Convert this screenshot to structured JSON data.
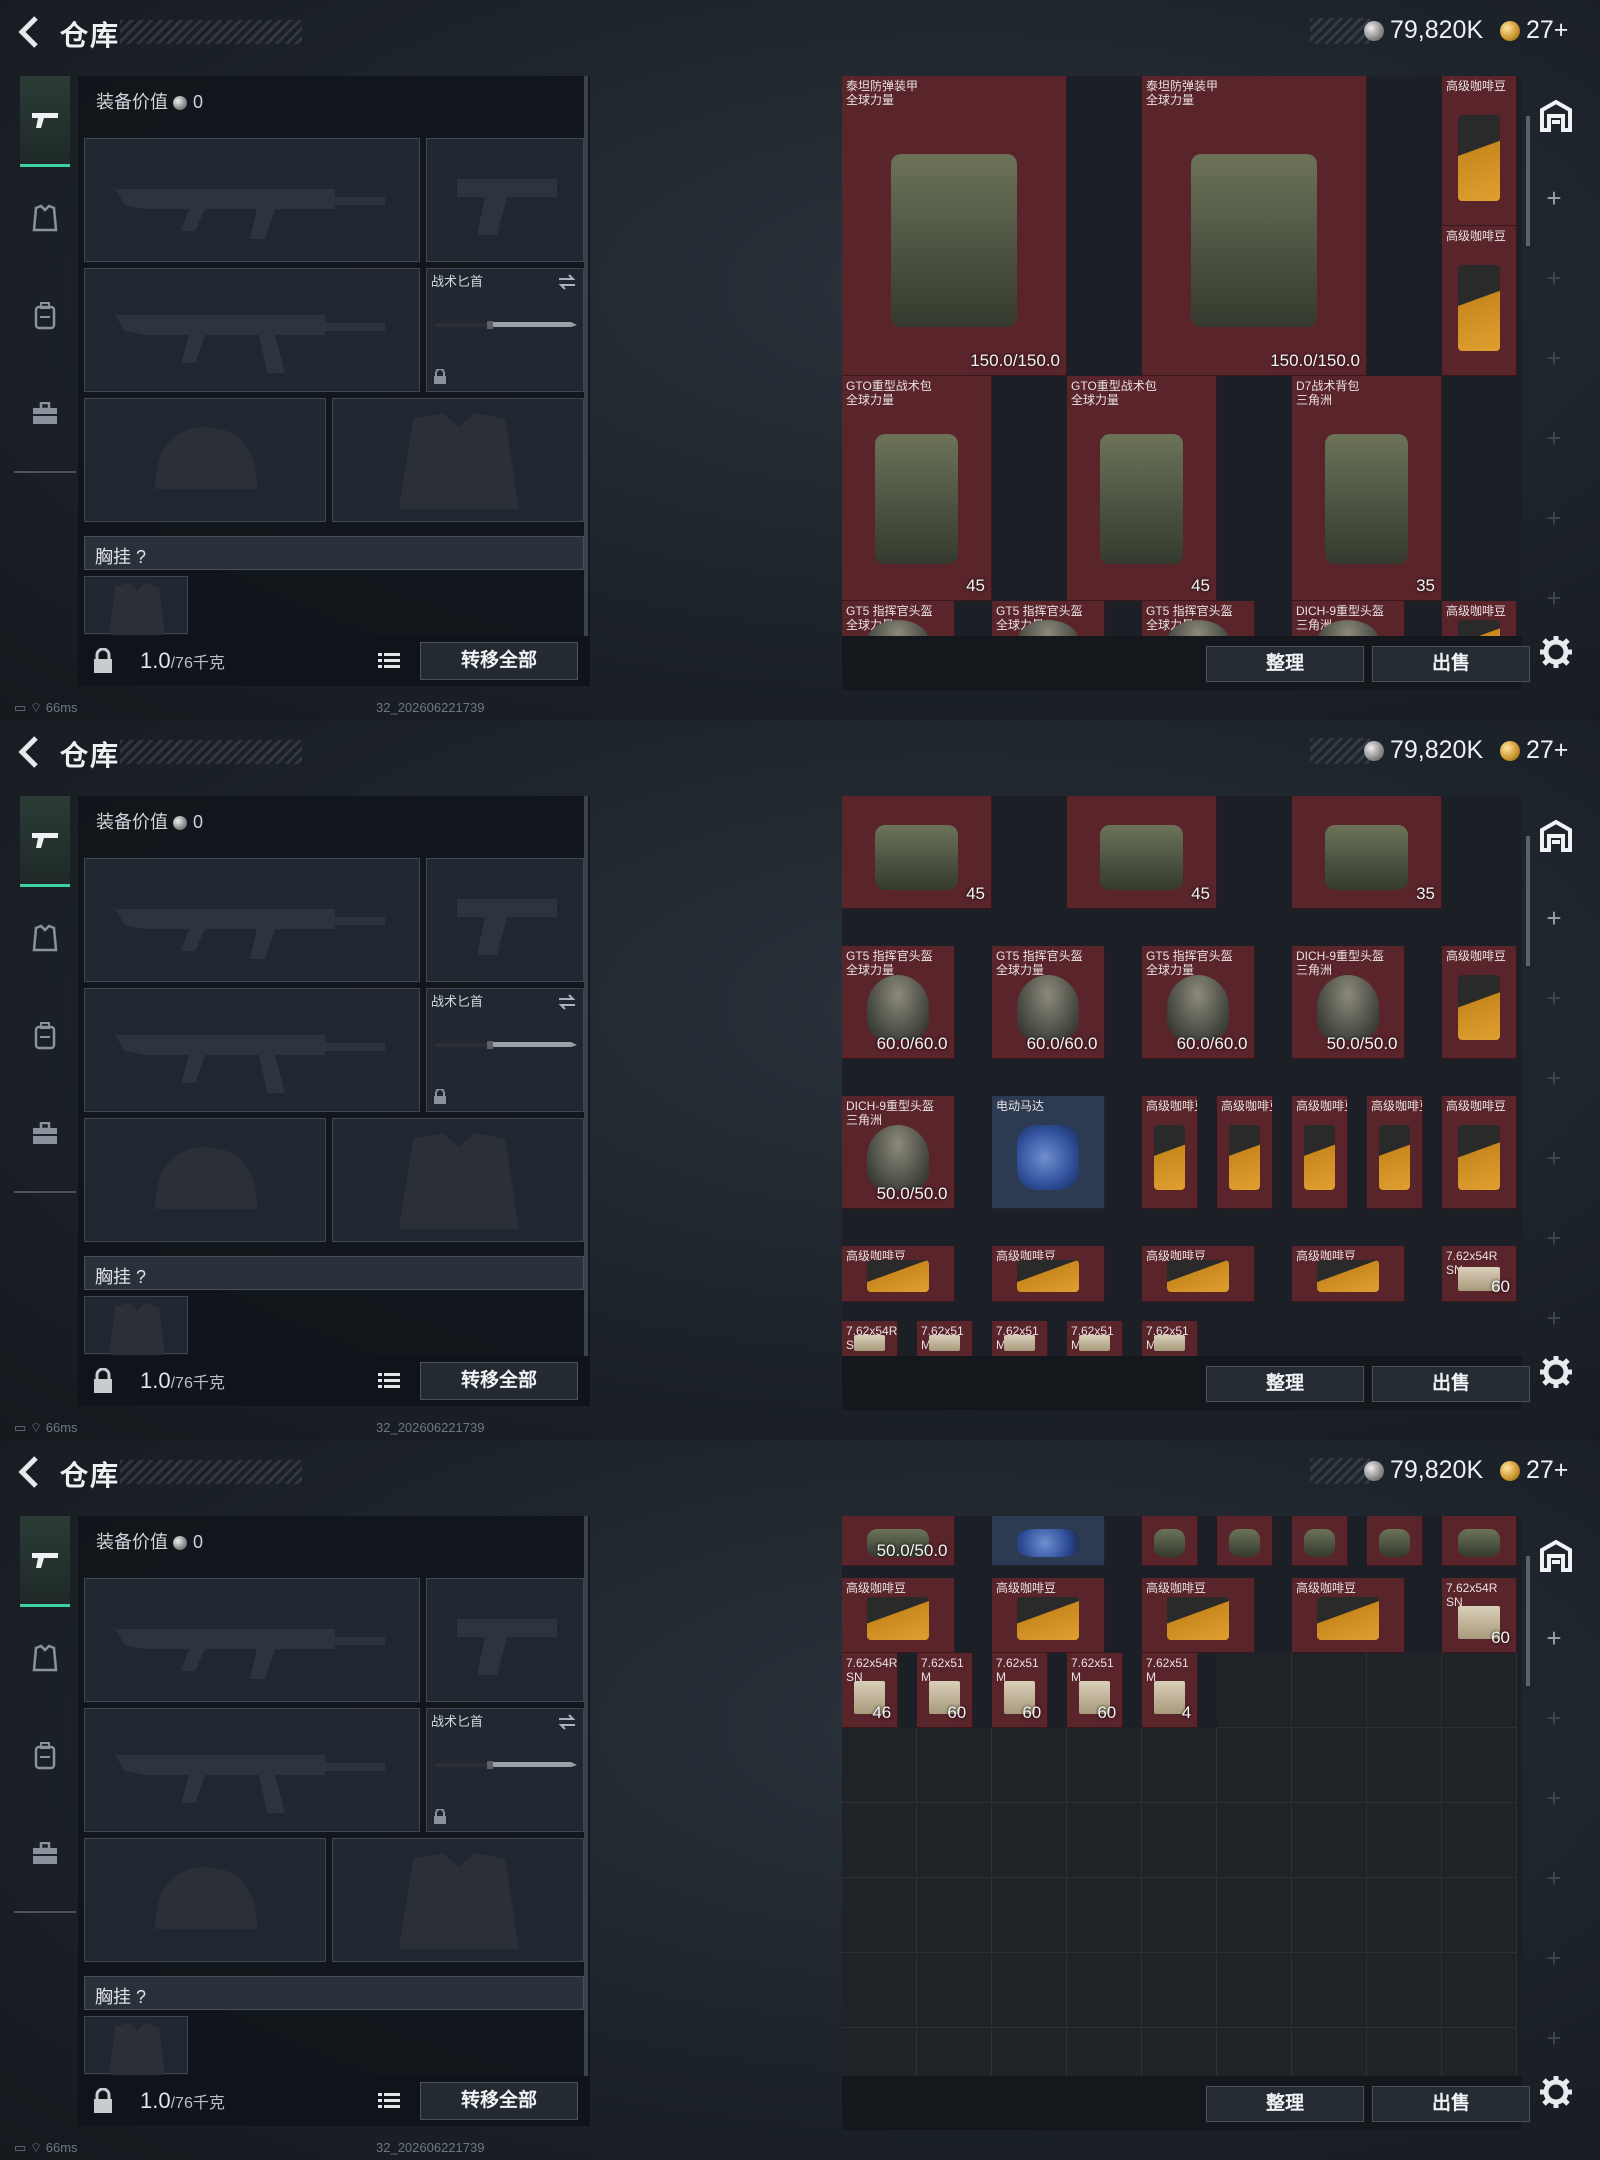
{
  "header": {
    "back_icon": "back-arrow-icon",
    "title": "仓库",
    "silver": "79,820K",
    "gold": "27+"
  },
  "equipment": {
    "value_label": "装备价值",
    "value": "0",
    "knife_label": "战术匕首",
    "chest_label": "胸挂 ?",
    "weight": "1.0",
    "weight_max": "/76千克",
    "transfer_all": "转移全部"
  },
  "stash": {
    "sort": "整理",
    "sell": "出售",
    "panel1": [
      {
        "n1": "泰坦防弹装甲",
        "n2": "全球力量",
        "val": "150.0/150.0"
      },
      {
        "n1": "泰坦防弹装甲",
        "n2": "全球力量",
        "val": "150.0/150.0"
      },
      {
        "n1": "高级咖啡豆",
        "n2": "",
        "val": ""
      },
      {
        "n1": "高级咖啡豆",
        "n2": "",
        "val": ""
      },
      {
        "n1": "GTO重型战术包",
        "n2": "全球力量",
        "val": "45"
      },
      {
        "n1": "GTO重型战术包",
        "n2": "全球力量",
        "val": "45"
      },
      {
        "n1": "D7战术背包",
        "n2": "三角洲",
        "val": "35"
      },
      {
        "n1": "GT5 指挥官头盔",
        "n2": "全球力量",
        "val": ""
      },
      {
        "n1": "GT5 指挥官头盔",
        "n2": "全球力量",
        "val": ""
      },
      {
        "n1": "GT5 指挥官头盔",
        "n2": "全球力量",
        "val": ""
      },
      {
        "n1": "DICH-9重型头盔",
        "n2": "三角洲",
        "val": ""
      },
      {
        "n1": "高级咖啡豆",
        "n2": "",
        "val": ""
      }
    ],
    "panel2": [
      {
        "n1": "",
        "n2": "",
        "val": "45"
      },
      {
        "n1": "",
        "n2": "",
        "val": "45"
      },
      {
        "n1": "",
        "n2": "",
        "val": "35"
      },
      {
        "n1": "GT5 指挥官头盔",
        "n2": "全球力量",
        "val": "60.0/60.0"
      },
      {
        "n1": "GT5 指挥官头盔",
        "n2": "全球力量",
        "val": "60.0/60.0"
      },
      {
        "n1": "GT5 指挥官头盔",
        "n2": "全球力量",
        "val": "60.0/60.0"
      },
      {
        "n1": "DICH-9重型头盔",
        "n2": "三角洲",
        "val": "50.0/50.0"
      },
      {
        "n1": "高级咖啡豆",
        "n2": "",
        "val": ""
      },
      {
        "n1": "DICH-9重型头盔",
        "n2": "三角洲",
        "val": "50.0/50.0"
      },
      {
        "n1": "电动马达",
        "n2": "",
        "val": ""
      },
      {
        "n1": "高级咖啡豆",
        "n2": "",
        "val": ""
      },
      {
        "n1": "高级咖啡豆",
        "n2": "",
        "val": ""
      },
      {
        "n1": "高级咖啡豆",
        "n2": "",
        "val": ""
      },
      {
        "n1": "高级咖啡豆",
        "n2": "",
        "val": ""
      },
      {
        "n1": "高级咖啡豆",
        "n2": "",
        "val": ""
      },
      {
        "n1": "高级咖啡豆",
        "n2": "",
        "val": ""
      },
      {
        "n1": "高级咖啡豆",
        "n2": "",
        "val": ""
      },
      {
        "n1": "高级咖啡豆",
        "n2": "",
        "val": ""
      },
      {
        "n1": "高级咖啡豆",
        "n2": "",
        "val": ""
      },
      {
        "n1": "7.62x54R",
        "n2": "SN",
        "val": "60"
      },
      {
        "n1": "7.62x54R",
        "n2": "SN",
        "val": ""
      },
      {
        "n1": "7.62x51",
        "n2": "M",
        "val": ""
      },
      {
        "n1": "7.62x51",
        "n2": "M",
        "val": ""
      },
      {
        "n1": "7.62x51",
        "n2": "M",
        "val": ""
      },
      {
        "n1": "7.62x51",
        "n2": "M",
        "val": ""
      }
    ],
    "panel3": [
      {
        "n1": "",
        "n2": "",
        "val": "50.0/50.0"
      },
      {
        "n1": "",
        "n2": "",
        "val": ""
      },
      {
        "n1": "",
        "n2": "",
        "val": ""
      },
      {
        "n1": "",
        "n2": "",
        "val": ""
      },
      {
        "n1": "",
        "n2": "",
        "val": ""
      },
      {
        "n1": "",
        "n2": "",
        "val": ""
      },
      {
        "n1": "",
        "n2": "",
        "val": ""
      },
      {
        "n1": "高级咖啡豆",
        "n2": "",
        "val": ""
      },
      {
        "n1": "高级咖啡豆",
        "n2": "",
        "val": ""
      },
      {
        "n1": "高级咖啡豆",
        "n2": "",
        "val": ""
      },
      {
        "n1": "高级咖啡豆",
        "n2": "",
        "val": ""
      },
      {
        "n1": "7.62x54R",
        "n2": "SN",
        "val": "60"
      },
      {
        "n1": "7.62x54R",
        "n2": "SN",
        "val": "46"
      },
      {
        "n1": "7.62x51",
        "n2": "M",
        "val": "60"
      },
      {
        "n1": "7.62x51",
        "n2": "M",
        "val": "60"
      },
      {
        "n1": "7.62x51",
        "n2": "M",
        "val": "60"
      },
      {
        "n1": "7.62x51",
        "n2": "M",
        "val": "4"
      }
    ]
  },
  "status": {
    "ping": "66ms",
    "build": "32_20260622173​9"
  },
  "colors": {
    "accent": "#3fd1a6",
    "cell_red": "#5a242b",
    "cell_blue": "#2c3a52"
  }
}
